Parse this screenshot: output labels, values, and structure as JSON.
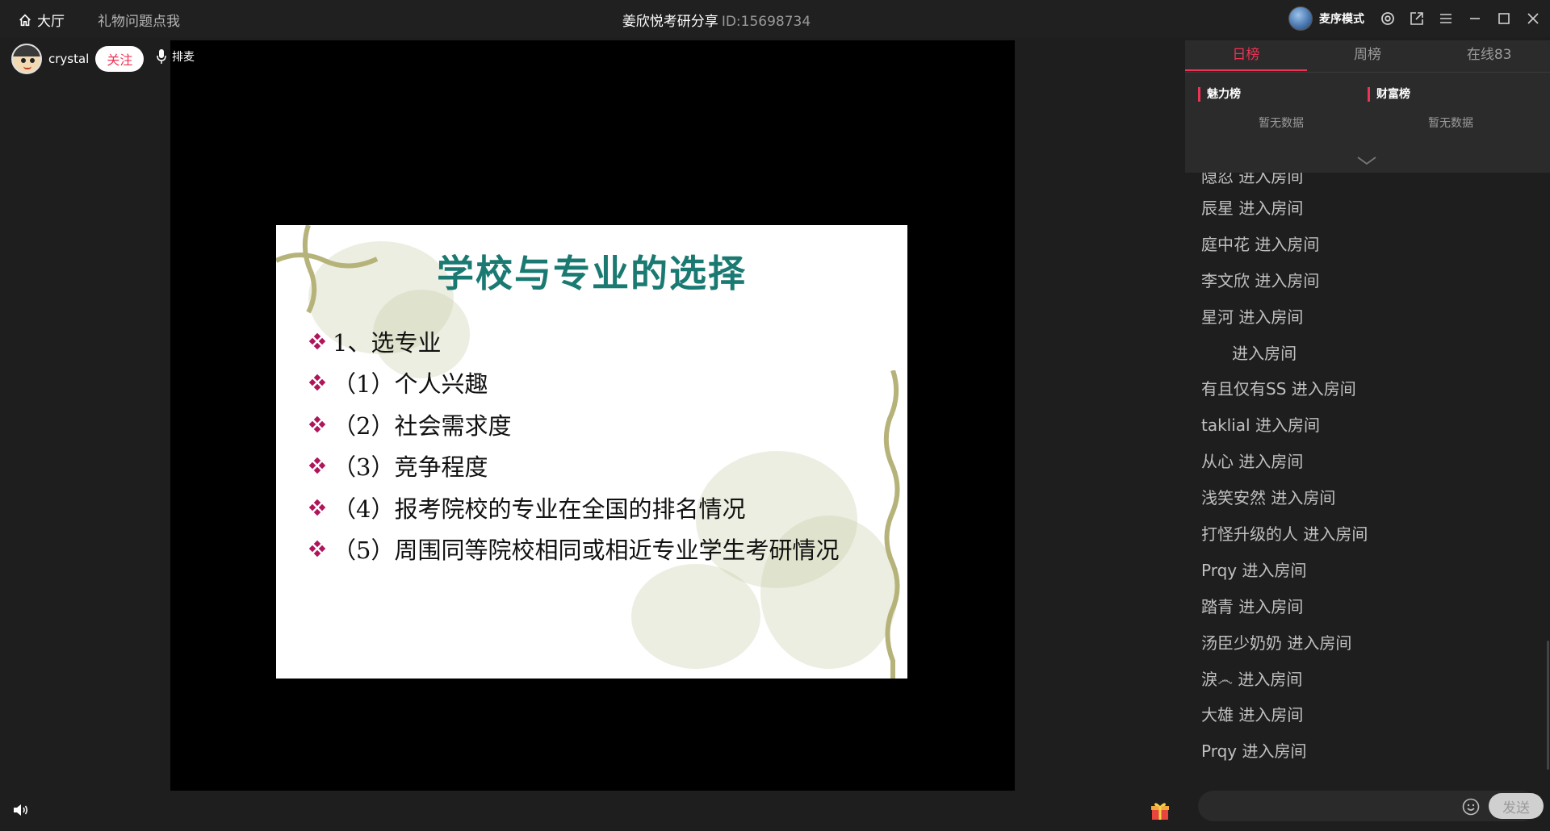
{
  "titlebar": {
    "home_label": "大厅",
    "link_label": "礼物问题点我",
    "room_title": "姜欣悦考研分享",
    "room_id": "ID:15698734",
    "mode_label": "麦序模式"
  },
  "stage": {
    "anchor_name": "crystal",
    "follow_label": "关注",
    "queue_label": "排麦"
  },
  "slide": {
    "title": "学校与专业的选择",
    "items": [
      "1、选专业",
      "（1）个人兴趣",
      "（2）社会需求度",
      "（3）竞争程度",
      "（4）报考院校的专业在全国的排名情况",
      "（5）周围同等院校相同或相近专业学生考研情况"
    ]
  },
  "rank": {
    "tabs": [
      "日榜",
      "周榜",
      "在线83"
    ],
    "active_tab": "日榜",
    "charm_title": "魅力榜",
    "wealth_title": "财富榜",
    "empty_text": "暂无数据"
  },
  "chat": {
    "messages": [
      "隐忍 进入房间",
      "辰星 进入房间",
      "庭中花 进入房间",
      "李文欣 进入房间",
      "星河 进入房间",
      "      进入房间",
      "有且仅有SS 进入房间",
      "taklial 进入房间",
      "从心 进入房间",
      "浅笑安然 进入房间",
      "打怪升级的人 进入房间",
      "Prqy 进入房间",
      "踏青 进入房间",
      "汤臣少奶奶 进入房间",
      "淚෴ 进入房间",
      "大雄 进入房间",
      "Prqy 进入房间"
    ],
    "input_placeholder": "",
    "send_label": "发送"
  },
  "colors": {
    "accent": "#ee3355",
    "slide_title": "#1a7a72",
    "bullet": "#b0145a",
    "background": "#1e1e1e"
  }
}
